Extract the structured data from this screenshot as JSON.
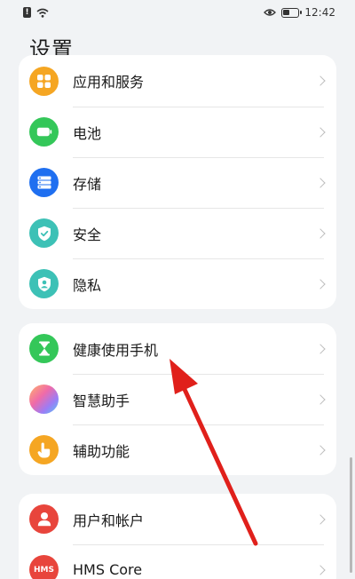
{
  "status_bar": {
    "time": "12:42",
    "icons": [
      "sim-alert-icon",
      "wifi-icon",
      "eye-icon",
      "battery-icon"
    ]
  },
  "page": {
    "title": "设置"
  },
  "groups": [
    {
      "items": [
        {
          "label": "应用和服务",
          "icon": "apps-icon",
          "color": "#f5a623"
        },
        {
          "label": "电池",
          "icon": "battery-icon",
          "color": "#34c759"
        },
        {
          "label": "存储",
          "icon": "storage-icon",
          "color": "#1f6ff0"
        },
        {
          "label": "安全",
          "icon": "shield-icon",
          "color": "#3dc1b6"
        },
        {
          "label": "隐私",
          "icon": "privacy-icon",
          "color": "#3dc1b6"
        }
      ]
    },
    {
      "items": [
        {
          "label": "健康使用手机",
          "icon": "hourglass-icon",
          "color": "#34c759"
        },
        {
          "label": "智慧助手",
          "icon": "assistant-icon",
          "color": "#b983f2"
        },
        {
          "label": "辅助功能",
          "icon": "hand-icon",
          "color": "#f5a623"
        }
      ]
    },
    {
      "items": [
        {
          "label": "用户和帐户",
          "icon": "user-icon",
          "color": "#e8453c"
        },
        {
          "label": "HMS Core",
          "icon": "hms-icon",
          "color": "#e8453c",
          "badge_text": "HMS"
        }
      ]
    }
  ],
  "annotation": {
    "color": "#e0201b"
  }
}
